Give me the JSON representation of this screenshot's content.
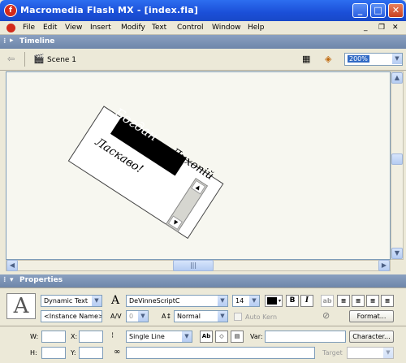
{
  "window": {
    "title": "Macromedia Flash MX - [index.fla]",
    "app_icon": "flash-f-icon",
    "min_label": "_",
    "max_label": "□",
    "close_label": "✕"
  },
  "menu": {
    "items": [
      "File",
      "Edit",
      "View",
      "Insert",
      "Modify",
      "Text",
      "Control",
      "Window",
      "Help"
    ],
    "doc_min": "_",
    "doc_restore": "❐",
    "doc_close": "✕"
  },
  "timeline": {
    "label": "Timeline"
  },
  "scene": {
    "label": "Scene 1",
    "zoom": "200%"
  },
  "stage": {
    "text_selected": "Богдан",
    "text_rest": "Лихопій",
    "text_line2": "Ласкаво!"
  },
  "properties": {
    "label": "Properties",
    "text_type": "Dynamic Text",
    "instance_name": "<Instance Name>",
    "font": "DeVinneScriptC",
    "font_size": "14",
    "color": "#000000",
    "bold": "B",
    "italic": "I",
    "char_spacing": "0",
    "baseline": "Normal",
    "auto_kern": "Auto Kern",
    "format_button": "Format...",
    "w_label": "W:",
    "x_label": "X:",
    "h_label": "H:",
    "y_label": "Y:",
    "line_type": "Single Line",
    "var_label": "Var:",
    "character_button": "Character...",
    "target_label": "Target",
    "char_spacing_label": "A/V",
    "baseline_label": "A↕"
  }
}
